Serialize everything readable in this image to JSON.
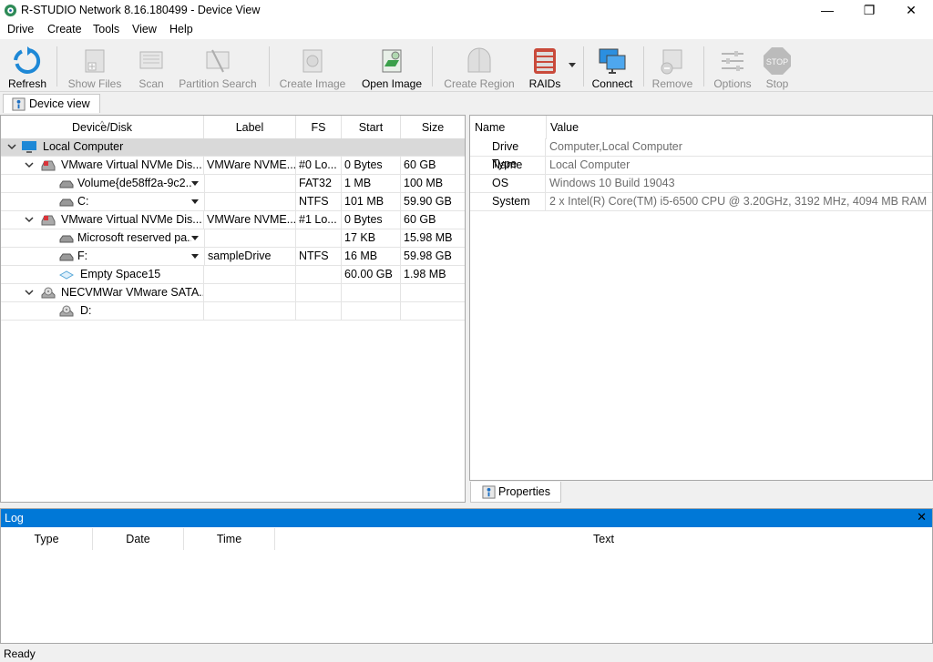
{
  "window": {
    "title": "R-STUDIO Network 8.16.180499 - Device View",
    "minimize": "—",
    "restore": "❐",
    "close": "✕"
  },
  "menu": [
    "Drive",
    "Create",
    "Tools",
    "View",
    "Help"
  ],
  "toolbar": {
    "refresh": "Refresh",
    "show_files": "Show Files",
    "scan": "Scan",
    "partition_search": "Partition Search",
    "create_image": "Create Image",
    "open_image": "Open Image",
    "create_region": "Create Region",
    "raids": "RAIDs",
    "connect": "Connect",
    "remove": "Remove",
    "options": "Options",
    "stop": "Stop",
    "stop_icon_text": "STOP"
  },
  "tabs": {
    "device_view": "Device view",
    "properties": "Properties"
  },
  "device_table": {
    "columns": [
      "Device/Disk",
      "Label",
      "FS",
      "Start",
      "Size"
    ],
    "rows": [
      {
        "name": "Local Computer",
        "label": "",
        "fs": "",
        "start": "",
        "size": ""
      },
      {
        "name": "VMware Virtual NVMe Dis...",
        "label": "VMWare NVME...",
        "fs": "#0 Lo...",
        "start": "0 Bytes",
        "size": "60 GB"
      },
      {
        "name": "Volume{de58ff2a-9c2...",
        "label": "",
        "fs": "FAT32",
        "start": "1 MB",
        "size": "100 MB"
      },
      {
        "name": "C:",
        "label": "",
        "fs": "NTFS",
        "start": "101 MB",
        "size": "59.90 GB"
      },
      {
        "name": "VMware Virtual NVMe Dis...",
        "label": "VMWare NVME...",
        "fs": "#1 Lo...",
        "start": "0 Bytes",
        "size": "60 GB"
      },
      {
        "name": "Microsoft reserved pa...",
        "label": "",
        "fs": "",
        "start": "17 KB",
        "size": "15.98 MB"
      },
      {
        "name": "F:",
        "label": "sampleDrive",
        "fs": "NTFS",
        "start": "16 MB",
        "size": "59.98 GB"
      },
      {
        "name": "Empty Space15",
        "label": "",
        "fs": "",
        "start": "60.00 GB",
        "size": "1.98 MB"
      },
      {
        "name": "NECVMWar VMware SATA...",
        "label": "",
        "fs": "",
        "start": "",
        "size": ""
      },
      {
        "name": "D:",
        "label": "",
        "fs": "",
        "start": "",
        "size": ""
      }
    ]
  },
  "properties": {
    "columns": [
      "Name",
      "Value"
    ],
    "rows": [
      {
        "name": "Drive Type",
        "value": "Computer,Local Computer"
      },
      {
        "name": "Name",
        "value": "Local Computer"
      },
      {
        "name": "OS",
        "value": "Windows 10 Build 19043"
      },
      {
        "name": "System",
        "value": "2 x Intel(R) Core(TM) i5-6500 CPU @ 3.20GHz, 3192 MHz, 4094 MB RAM"
      }
    ]
  },
  "log": {
    "title": "Log",
    "close": "✕",
    "columns": [
      "Type",
      "Date",
      "Time",
      "Text"
    ]
  },
  "status": "Ready",
  "colors": {
    "accent": "#0078d7",
    "group_row": "#d9d9d9",
    "disabled_text": "#8c8c8c"
  }
}
